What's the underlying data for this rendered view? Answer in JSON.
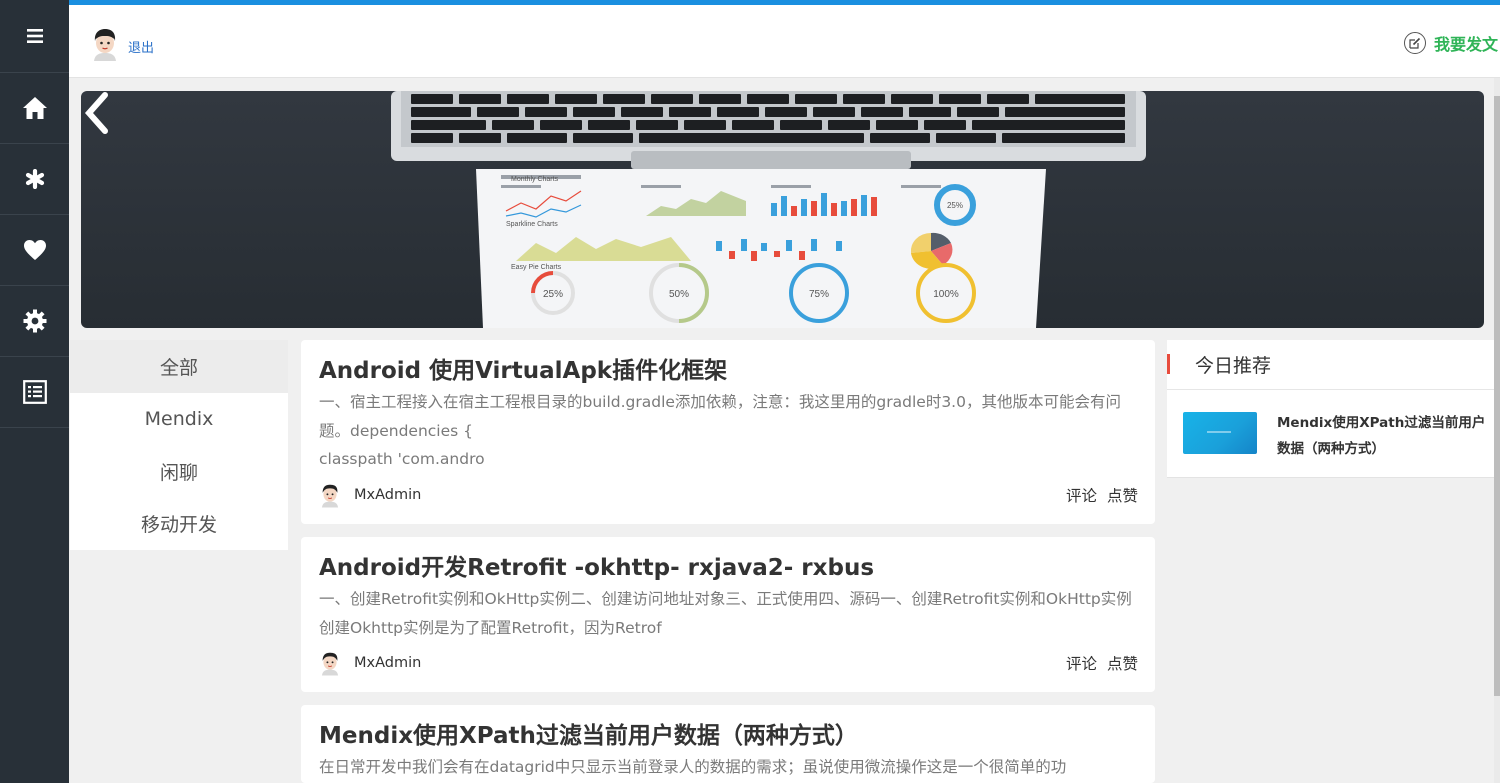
{
  "rail": {
    "items": [
      {
        "icon": "menu-icon"
      },
      {
        "icon": "home-icon"
      },
      {
        "icon": "asterisk-icon"
      },
      {
        "icon": "heart-icon"
      },
      {
        "icon": "gear-icon"
      },
      {
        "icon": "list-icon"
      }
    ]
  },
  "topbar": {
    "logout_label": "退出",
    "post_label": "我要发文",
    "accent_color": "#1a8fe0",
    "post_color": "#2fb457"
  },
  "categories": [
    {
      "label": "全部",
      "active": true
    },
    {
      "label": "Mendix",
      "active": false
    },
    {
      "label": "闲聊",
      "active": false
    },
    {
      "label": "移动开发",
      "active": false
    }
  ],
  "articles": [
    {
      "title": "Android 使用VirtualApk插件化框架",
      "summary": "一、宿主工程接入在宿主工程根目录的build.gradle添加依赖，注意：我这里用的gradle时3.0，其他版本可能会有问题。dependencies {",
      "summary2": "classpath 'com.andro",
      "author": "MxAdmin",
      "comment_label": "评论",
      "like_label": "点赞"
    },
    {
      "title": "Android开发Retrofit -okhttp- rxjava2- rxbus",
      "summary": " 一、创建Retrofit实例和OkHttp实例二、创建访问地址对象三、正式使用四、源码一、创建Retrofit实例和OkHttp实例创建Okhttp实例是为了配置Retrofit，因为Retrof",
      "summary2": "",
      "author": "MxAdmin",
      "comment_label": "评论",
      "like_label": "点赞"
    },
    {
      "title": "Mendix使用XPath过滤当前用户数据（两种方式）",
      "summary": "在日常开发中我们会有在datagrid中只显示当前登录人的数据的需求；虽说使用微流操作这是一个很简单的功",
      "summary2": "",
      "author": "",
      "comment_label": "",
      "like_label": ""
    }
  ],
  "recommend": {
    "heading": "今日推荐",
    "items": [
      {
        "title": "Mendix使用XPath过滤当前用户数据（两种方式）"
      }
    ]
  },
  "banner": {
    "doc_title": "Monthly Charts",
    "section_sparkline": "Sparkline Charts",
    "section_pie": "Easy Pie Charts",
    "gauges": [
      "25%",
      "50%",
      "75%",
      "100%"
    ]
  }
}
